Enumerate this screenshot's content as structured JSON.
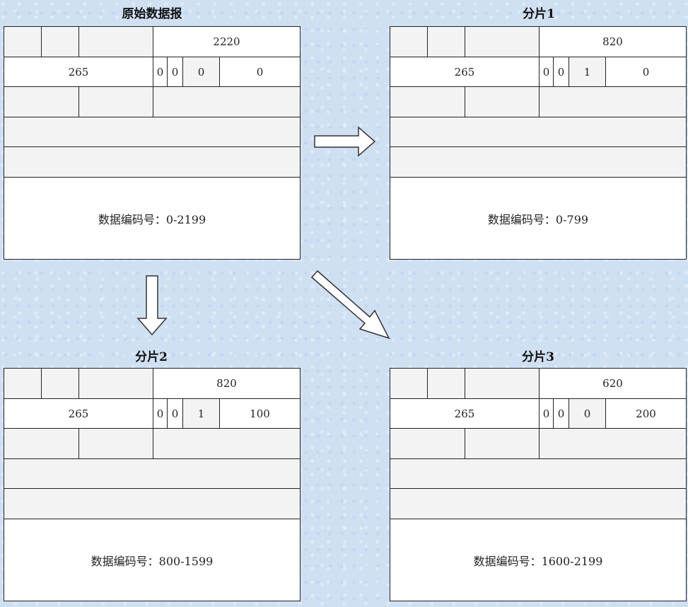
{
  "titles": {
    "original": "原始数据报",
    "frag1": "分片1",
    "frag2": "分片2",
    "frag3": "分片3"
  },
  "packets": {
    "original": {
      "total_length": "2220",
      "id": "265",
      "flag0": "0",
      "flag_df": "0",
      "flag_mf": "0",
      "offset": "0",
      "data": "数据编码号：0-2199"
    },
    "frag1": {
      "total_length": "820",
      "id": "265",
      "flag0": "0",
      "flag_df": "0",
      "flag_mf": "1",
      "offset": "0",
      "data": "数据编码号：0-799"
    },
    "frag2": {
      "total_length": "820",
      "id": "265",
      "flag0": "0",
      "flag_df": "0",
      "flag_mf": "1",
      "offset": "100",
      "data": "数据编码号：800-1599"
    },
    "frag3": {
      "total_length": "620",
      "id": "265",
      "flag0": "0",
      "flag_df": "0",
      "flag_mf": "0",
      "offset": "200",
      "data": "数据编码号：1600-2199"
    }
  }
}
